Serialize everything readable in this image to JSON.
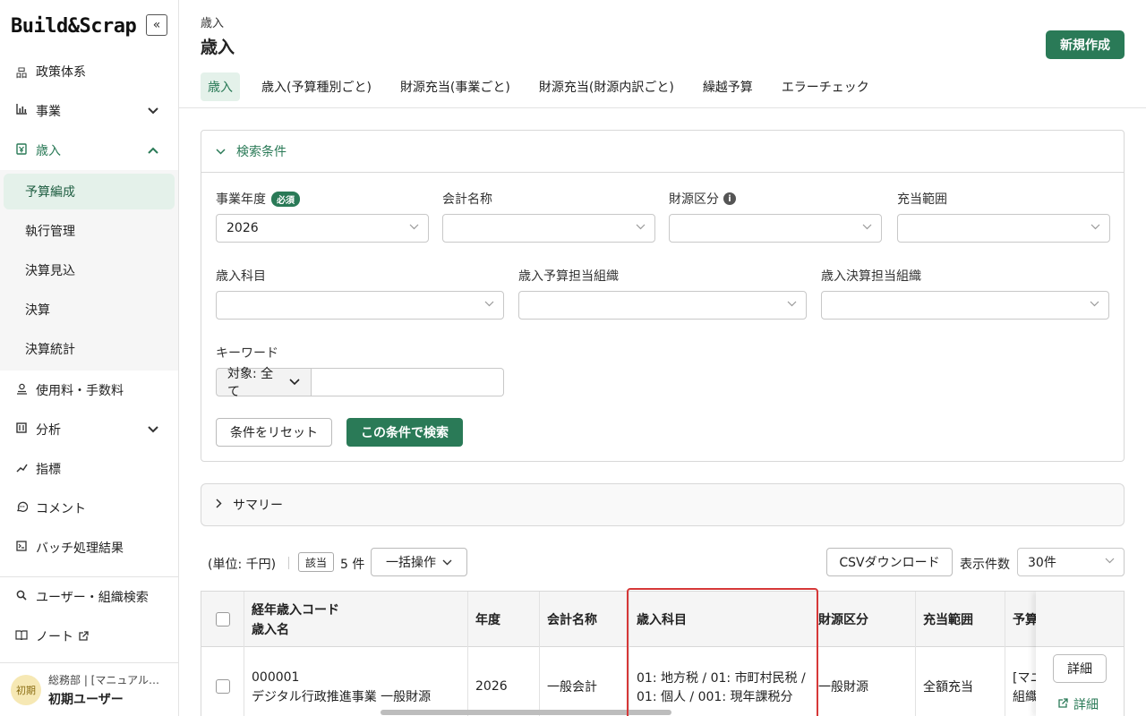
{
  "app": {
    "logo": "Build&Scrap",
    "collapse_icon": "«"
  },
  "sidebar": {
    "items": [
      {
        "label": "政策体系",
        "icon": "hierarchy-icon"
      },
      {
        "label": "事業",
        "icon": "bar-chart-icon",
        "chevron": "⌄"
      },
      {
        "label": "歳入",
        "icon": "revenue-icon",
        "chevron": "⌃"
      }
    ],
    "sub_items": [
      {
        "label": "予算編成",
        "active": true
      },
      {
        "label": "執行管理"
      },
      {
        "label": "決算見込"
      },
      {
        "label": "決算"
      },
      {
        "label": "決算統計"
      }
    ],
    "items_after": [
      {
        "label": "使用料・手数料"
      },
      {
        "label": "分析",
        "chevron": "⌄"
      },
      {
        "label": "指標"
      },
      {
        "label": "コメント"
      },
      {
        "label": "バッチ処理結果"
      }
    ],
    "bottom_items": [
      {
        "label": "ユーザー・組織検索"
      },
      {
        "label": "ノート"
      }
    ],
    "user": {
      "avatar": "初期",
      "dept": "総務部 | [マニュアル…",
      "name": "初期ユーザー"
    }
  },
  "header": {
    "breadcrumb": "歳入",
    "title": "歳入",
    "new_button": "新規作成",
    "tabs": [
      "歳入",
      "歳入(予算種別ごと)",
      "財源充当(事業ごと)",
      "財源充当(財源内訳ごと)",
      "繰越予算",
      "エラーチェック"
    ]
  },
  "search": {
    "title": "検索条件",
    "fiscal_year": {
      "label": "事業年度",
      "required": "必須",
      "value": "2026"
    },
    "account_name": {
      "label": "会計名称",
      "value": ""
    },
    "fund_category": {
      "label": "財源区分",
      "value": ""
    },
    "allocation_range": {
      "label": "充当範囲",
      "value": ""
    },
    "revenue_item": {
      "label": "歳入科目",
      "value": ""
    },
    "budget_org": {
      "label": "歳入予算担当組織",
      "value": ""
    },
    "settlement_org": {
      "label": "歳入決算担当組織",
      "value": ""
    },
    "keyword": {
      "label": "キーワード",
      "scope": "対象: 全て",
      "value": ""
    },
    "reset_button": "条件をリセット",
    "search_button": "この条件で検索"
  },
  "summary": {
    "label": "サマリー"
  },
  "toolbar": {
    "unit": "(単位: 千円)",
    "match_label": "該当",
    "count": "5 件",
    "bulk_action": "一括操作",
    "csv_download": "CSVダウンロード",
    "per_page_label": "表示件数",
    "per_page_value": "30件"
  },
  "table": {
    "headers": {
      "code_line1": "経年歳入コード",
      "code_line2": "歳入名",
      "year": "年度",
      "account": "会計名称",
      "revenue_item": "歳入科目",
      "fund_category": "財源区分",
      "allocation": "充当範囲",
      "budget": "予算"
    },
    "rows": [
      {
        "code": "000001",
        "name": "デジタル行政推進事業 一般財源",
        "year": "2026",
        "account": "一般会計",
        "revenue_item_line1": "01: 地方税 / 01: 市町村民税 /",
        "revenue_item_line2": "01: 個人 / 001: 現年課税分",
        "fund_category": "一般財源",
        "allocation": "全額充当",
        "budget_line1": "[マニ",
        "budget_line2": "組織",
        "detail_button": "詳細",
        "detail_link": "詳細"
      }
    ]
  }
}
